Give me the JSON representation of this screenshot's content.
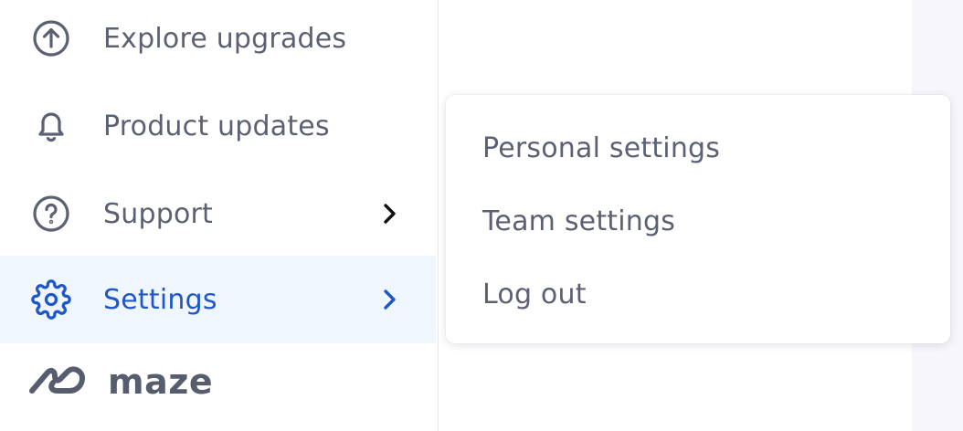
{
  "sidebar": {
    "items": [
      {
        "label": "Explore upgrades",
        "icon": "arrow-up-circle-icon"
      },
      {
        "label": "Product updates",
        "icon": "bell-icon"
      },
      {
        "label": "Support",
        "icon": "help-circle-icon",
        "has_submenu": true
      },
      {
        "label": "Settings",
        "icon": "gear-icon",
        "has_submenu": true,
        "active": true
      }
    ],
    "logo_text": "maze"
  },
  "settings_menu": {
    "items": [
      {
        "label": "Personal settings"
      },
      {
        "label": "Team settings"
      },
      {
        "label": "Log out"
      }
    ]
  },
  "colors": {
    "text": "#5b6173",
    "accent": "#1f57c8",
    "active_bg": "#f0f6fd",
    "right_panel_bg": "#f6f6fb"
  }
}
